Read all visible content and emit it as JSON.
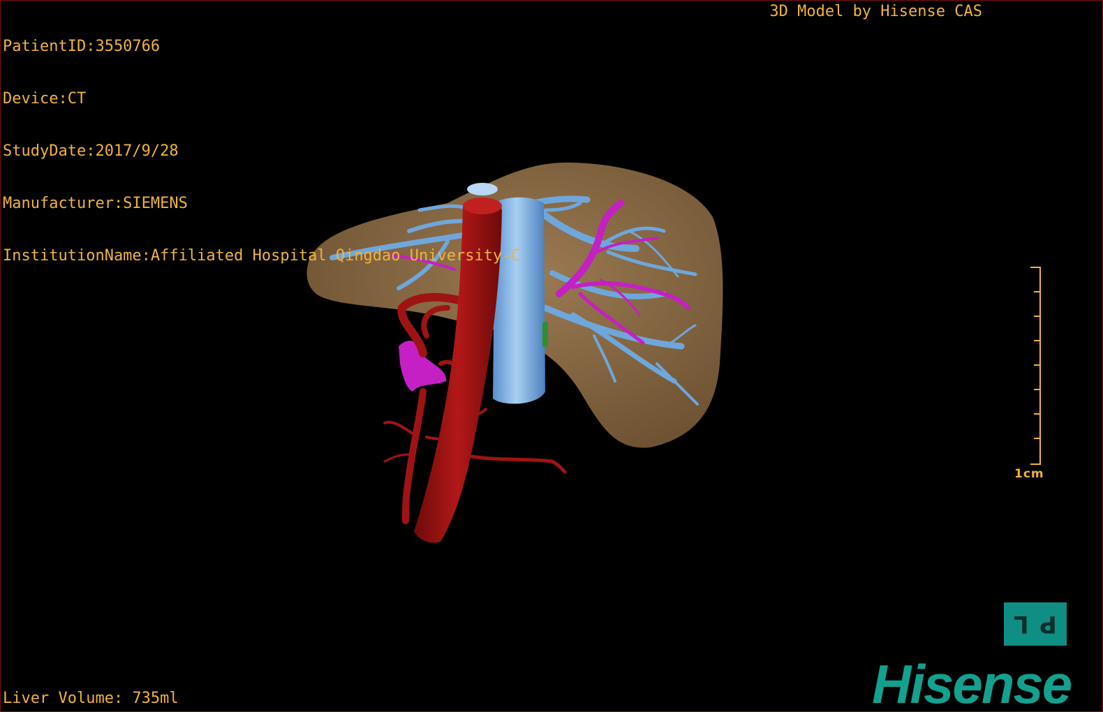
{
  "dicom": {
    "patient_id": "PatientID:3550766",
    "device": "Device:CT",
    "study_date": "StudyDate:2017/9/28",
    "manufacturer": "Manufacturer:SIEMENS",
    "institution": "InstitutionName:Affiliated Hospital Qingdao University-C"
  },
  "credit": "3D Model by Hisense CAS",
  "liver_volume": "Liver Volume: 735ml",
  "scale": {
    "label": "1cm"
  },
  "orientation": {
    "face_left": "L",
    "face_right": "P"
  },
  "brand": "Hisense",
  "colors": {
    "text": "#f0b43c",
    "liver": "#8a6a44",
    "portal_vein": "#6fa7dc",
    "hepatic_vein": "#c420c4",
    "artery": "#9e1414",
    "brand": "#13a18f"
  }
}
